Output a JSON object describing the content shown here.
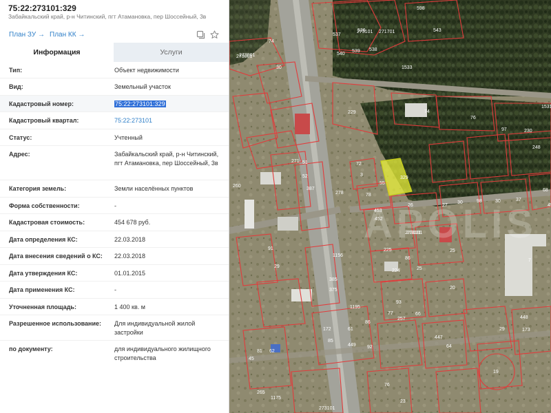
{
  "header": {
    "cadastral_number": "75:22:273101:329",
    "address_short": "Забайкальский край, р-н Читинский, пгт Атамановка, пер Шоссейный, 3в",
    "plan_zu": "План ЗУ →",
    "plan_kk": "План КК →"
  },
  "tabs": {
    "info": "Информация",
    "services": "Услуги"
  },
  "rows": [
    {
      "label": "Тип:",
      "value": "Объект недвижимости"
    },
    {
      "label": "Вид:",
      "value": "Земельный участок"
    },
    {
      "label": "Кадастровый номер:",
      "value": "75:22:273101:329"
    },
    {
      "label": "Кадастровый квартал:",
      "value": "75:22:273101"
    },
    {
      "label": "Статус:",
      "value": "Учтенный"
    },
    {
      "label": "Адрес:",
      "value": "Забайкальский край, р-н Читинский, пгт Атамановка, пер Шоссейный, 3в"
    },
    {
      "label": "Категория земель:",
      "value": "Земли населённых пунктов"
    },
    {
      "label": "Форма собственности:",
      "value": "-"
    },
    {
      "label": "Кадастровая стоимость:",
      "value": "454 678 руб."
    },
    {
      "label": "Дата определения КС:",
      "value": "22.03.2018"
    },
    {
      "label": "Дата внесения сведений о КС:",
      "value": "22.03.2018"
    },
    {
      "label": "Дата утверждения КС:",
      "value": "01.01.2015"
    },
    {
      "label": "Дата применения КС:",
      "value": "-"
    },
    {
      "label": "Уточненная площадь:",
      "value": "1 400 кв. м"
    },
    {
      "label": "Разрешенное использование:",
      "value": "Для индивидуальной жилой застройки"
    },
    {
      "label": "по документу:",
      "value": "для индивидуального жилищного строительства"
    }
  ],
  "map": {
    "watermark": "APOLIS",
    "quarter_labels": [
      "273101",
      "273101",
      "273001",
      "273101"
    ],
    "parcel_labels": [
      "598",
      "537",
      "536",
      "271701",
      "543",
      "540",
      "539",
      "538",
      "1533",
      "74",
      "30",
      "273001",
      "229",
      "74",
      "76",
      "1531",
      "97",
      "230",
      "248",
      "271",
      "51",
      "52",
      "387",
      "72",
      "3",
      "55",
      "329",
      "278",
      "260",
      "453",
      "27",
      "30",
      "98",
      "30",
      "37",
      "68",
      "45",
      "452",
      "91",
      "29",
      "78",
      "26",
      "273101",
      "225",
      "86",
      "25",
      "224",
      "20",
      "7",
      "25",
      "385",
      "375",
      "1156",
      "1195",
      "86",
      "93",
      "77",
      "257",
      "66",
      "447",
      "448",
      "173",
      "172",
      "85",
      "61",
      "449",
      "29",
      "92",
      "45",
      "81",
      "62",
      "64",
      "19",
      "76",
      "265",
      "1175",
      "23"
    ],
    "colors": {
      "parcel_border": "#e23b3b",
      "selected_fill": "#e8ef3a",
      "road": "#9c9c94"
    }
  }
}
